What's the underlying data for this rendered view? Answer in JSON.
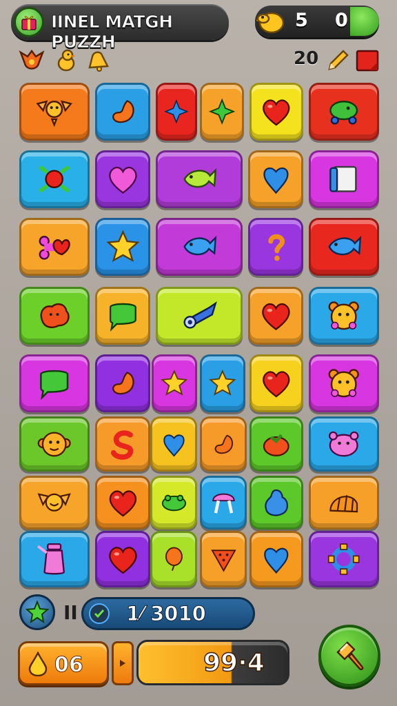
{
  "header": {
    "title": "IINEL MATGH PUZZH",
    "coins": "5",
    "gems": "0"
  },
  "status": {
    "moves": "20",
    "left_icons": [
      "bird-emblem-icon",
      "chick-icon",
      "bell-icon"
    ],
    "right_icons": [
      "pencil-icon",
      "red-flag-icon"
    ]
  },
  "board": {
    "tiles": [
      {
        "color": "#f47a1c",
        "icon": "winged-orb-icon"
      },
      {
        "color": "#2a9fe6",
        "icon": "bean-icon"
      },
      {
        "color": "#e8261f",
        "icon": "blue-star4-icon"
      },
      {
        "color": "#f6a12a",
        "icon": "green-star4-icon"
      },
      {
        "color": "#f5e21f",
        "icon": "heart-icon"
      },
      {
        "color": "#e8301f",
        "icon": "turtle-icon"
      },
      {
        "color": "#2ab0e8",
        "icon": "arrows-ball-icon"
      },
      {
        "color": "#9a36e0",
        "icon": "pink-heart-icon"
      },
      {
        "color": "#b23cd9",
        "icon": "fish-icon"
      },
      {
        "color": "#f6a22a",
        "icon": "blue-diamond-icon"
      },
      {
        "color": "#d736e0",
        "icon": "scroll-icon"
      },
      {
        "color": "#f6a42a",
        "icon": "bone-heart-icon"
      },
      {
        "color": "#2a93e8",
        "icon": "star-icon"
      },
      {
        "color": "#c23ad8",
        "icon": "blue-fish-icon"
      },
      {
        "color": "#9a36e0",
        "icon": "question-icon"
      },
      {
        "color": "#e8281f",
        "icon": "blue-fish-icon"
      },
      {
        "color": "#6ccf2a",
        "icon": "blob-icon"
      },
      {
        "color": "#f6b32a",
        "icon": "speech-bubble-icon"
      },
      {
        "color": "#c3e82a",
        "icon": "rocket-icon"
      },
      {
        "color": "#f6a22a",
        "icon": "heart-icon"
      },
      {
        "color": "#2aa8e8",
        "icon": "bear-face-icon"
      },
      {
        "color": "#d736e0",
        "icon": "speech-bubble-icon"
      },
      {
        "color": "#9030e0",
        "icon": "bean-icon"
      },
      {
        "color": "#d736e0",
        "icon": "star-icon"
      },
      {
        "color": "#2a9fe6",
        "icon": "star-icon"
      },
      {
        "color": "#f6d21f",
        "icon": "heart-icon"
      },
      {
        "color": "#d736e0",
        "icon": "bear-face-icon"
      },
      {
        "color": "#6cc82a",
        "icon": "monkey-face-icon"
      },
      {
        "color": "#f69a2a",
        "icon": "swirl-icon"
      },
      {
        "color": "#f6c21f",
        "icon": "blue-diamond-icon"
      },
      {
        "color": "#f69a2a",
        "icon": "bean-icon"
      },
      {
        "color": "#5cc82a",
        "icon": "tomato-icon"
      },
      {
        "color": "#2aa8e8",
        "icon": "pink-pig-icon"
      },
      {
        "color": "#f6a42a",
        "icon": "winged-smile-icon"
      },
      {
        "color": "#f6901f",
        "icon": "heart-icon"
      },
      {
        "color": "#d5e82a",
        "icon": "frog-icon"
      },
      {
        "color": "#2aa8e8",
        "icon": "mushroom-icon"
      },
      {
        "color": "#5cc82a",
        "icon": "blue-blob-icon"
      },
      {
        "color": "#f6a02a",
        "icon": "shell-icon"
      },
      {
        "color": "#2aa8e8",
        "icon": "potion-jar-icon"
      },
      {
        "color": "#9030e0",
        "icon": "heart-icon"
      },
      {
        "color": "#a8e02a",
        "icon": "balloon-icon"
      },
      {
        "color": "#f6a02a",
        "icon": "cracker-icon"
      },
      {
        "color": "#f69a1f",
        "icon": "blue-diamond-icon"
      },
      {
        "color": "#9a36e0",
        "icon": "ring-icon"
      }
    ]
  },
  "footer": {
    "level": "II",
    "score": "1⁄ 3010",
    "drops": "06",
    "total": "99·4"
  }
}
